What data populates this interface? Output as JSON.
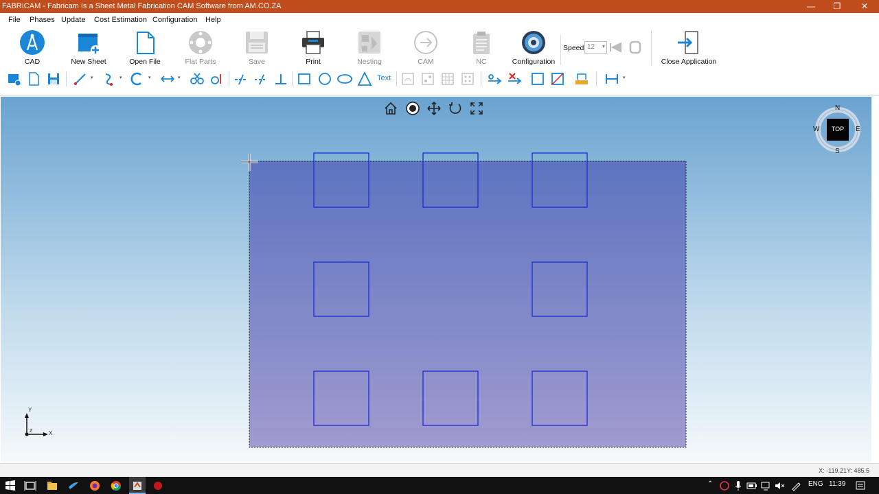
{
  "window": {
    "title": "FABRICAM - Fabricam Is a Sheet Metal Fabrication CAM Software from AM.CO.ZA"
  },
  "menu": [
    "File",
    "Phases",
    "Update",
    "Cost Estimation",
    "Configuration",
    "Help"
  ],
  "ribbon": {
    "cad": "CAD",
    "new_sheet": "New Sheet",
    "open_file": "Open File",
    "flat_parts": "Flat Parts",
    "save": "Save",
    "print": "Print",
    "nesting": "Nesting",
    "cam": "CAM",
    "nc": "NC",
    "configuration": "Configuration",
    "speed_label": "Speed",
    "speed_value": "12",
    "close_app": "Close Application"
  },
  "toolbar2": {
    "text_tool": "Text"
  },
  "viewcube": {
    "face": "TOP",
    "n": "N",
    "s": "S",
    "e": "E",
    "w": "W"
  },
  "axis": {
    "x": "X",
    "y": "Y",
    "z": "Z"
  },
  "status": {
    "coords": "X: -119.21Y: 485.5"
  },
  "taskbar": {
    "lang": "ENG",
    "time": "11:39"
  },
  "colors": {
    "accent": "#c24d1c",
    "sheet_fill": "#6f77c4",
    "hole_stroke": "#1c2bd6"
  }
}
